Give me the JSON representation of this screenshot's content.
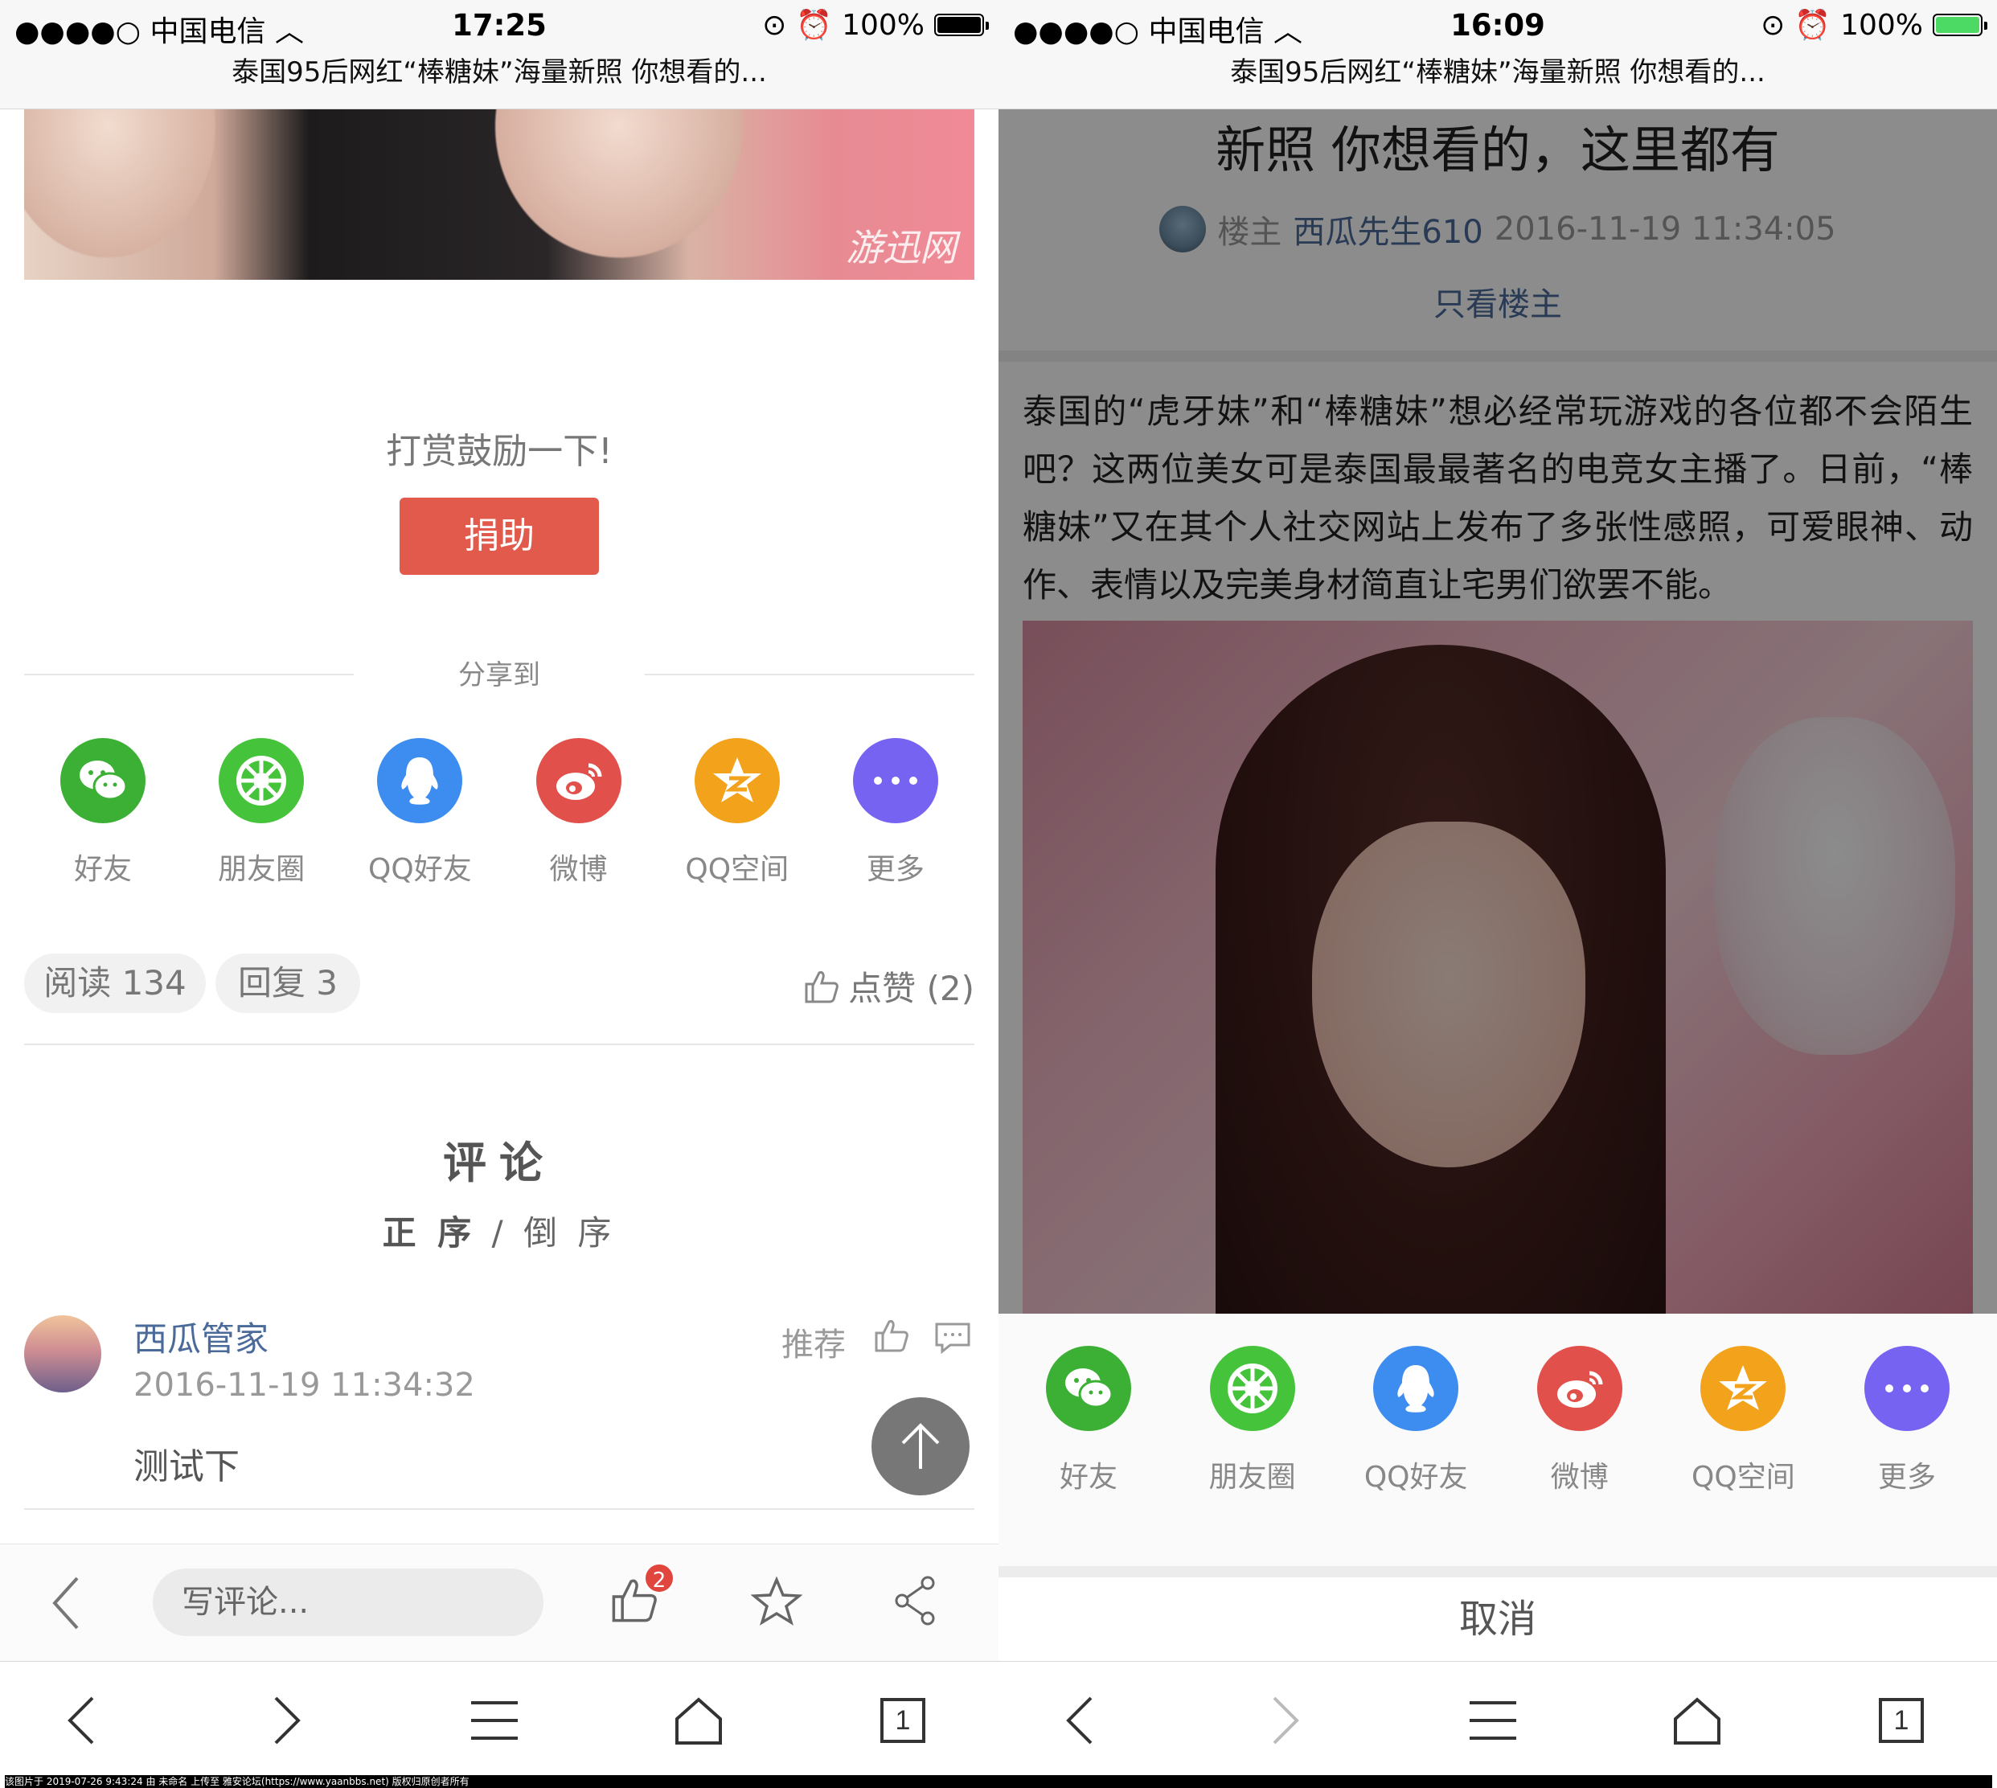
{
  "left": {
    "status": {
      "carrier": "●●●●○ 中国电信",
      "time": "17:25",
      "battery": "100%",
      "battery_color": "#000000"
    },
    "page_title": "泰国95后网红“棒糖妹”海量新照 你想看的...",
    "image_watermark": "游迅网",
    "reward": {
      "text": "打赏鼓励一下!",
      "button": "捐助",
      "button_color": "#e15a4c"
    },
    "share_label": "分享到",
    "share": [
      {
        "name": "好友",
        "icon": "wechat-icon",
        "color": "#3cb035"
      },
      {
        "name": "朋友圈",
        "icon": "moments-icon",
        "color": "#45c33a"
      },
      {
        "name": "QQ好友",
        "icon": "qq-icon",
        "color": "#3d8cf0"
      },
      {
        "name": "微博",
        "icon": "weibo-icon",
        "color": "#e2504b"
      },
      {
        "name": "QQ空间",
        "icon": "qzone-icon",
        "color": "#f3a21b"
      },
      {
        "name": "更多",
        "icon": "more-icon",
        "color": "#7763f2"
      }
    ],
    "stats": {
      "reads": "阅读 134",
      "replies": "回复 3",
      "likes": "点赞 (2)"
    },
    "comments": {
      "heading": "评论",
      "sort_asc": "正 序",
      "sort_sep": "/",
      "sort_desc": "倒 序",
      "items": [
        {
          "user": "西瓜管家",
          "time": "2016-11-19 11:34:32",
          "body": "测试下",
          "recommend": "推荐"
        }
      ]
    },
    "comment_bar": {
      "placeholder": "写评论...",
      "like_count": "2"
    },
    "tab_count": "1"
  },
  "right": {
    "status": {
      "carrier": "●●●●○ 中国电信",
      "time": "16:09",
      "battery": "100%",
      "battery_color": "#4cd964"
    },
    "page_title": "泰国95后网红“棒糖妹”海量新照 你想看的...",
    "article": {
      "title_tail": "新照 你想看的，这里都有",
      "author_role": "楼主",
      "author": "西瓜先生610",
      "time": "2016-11-19 11:34:05",
      "only_owner": "只看楼主",
      "paragraph": "泰国的“虎牙妹”和“棒糖妹”想必经常玩游戏的各位都不会陌生吧？这两位美女可是泰国最最著名的电竞女主播了。日前，“棒糖妹”又在其个人社交网站上发布了多张性感照，可爱眼神、动作、表情以及完美身材简直让宅男们欲罢不能。"
    },
    "share": [
      {
        "name": "好友",
        "icon": "wechat-icon",
        "color": "#3cb035"
      },
      {
        "name": "朋友圈",
        "icon": "moments-icon",
        "color": "#45c33a"
      },
      {
        "name": "QQ好友",
        "icon": "qq-icon",
        "color": "#3d8cf0"
      },
      {
        "name": "微博",
        "icon": "weibo-icon",
        "color": "#e2504b"
      },
      {
        "name": "QQ空间",
        "icon": "qzone-icon",
        "color": "#f3a21b"
      },
      {
        "name": "更多",
        "icon": "more-icon",
        "color": "#7763f2"
      }
    ],
    "cancel": "取消",
    "tab_count": "1"
  },
  "footer": "该图片于 2019-07-26 9:43:24 由 未命名 上传至 雅安论坛(https://www.yaanbbs.net) 版权归原创者所有"
}
